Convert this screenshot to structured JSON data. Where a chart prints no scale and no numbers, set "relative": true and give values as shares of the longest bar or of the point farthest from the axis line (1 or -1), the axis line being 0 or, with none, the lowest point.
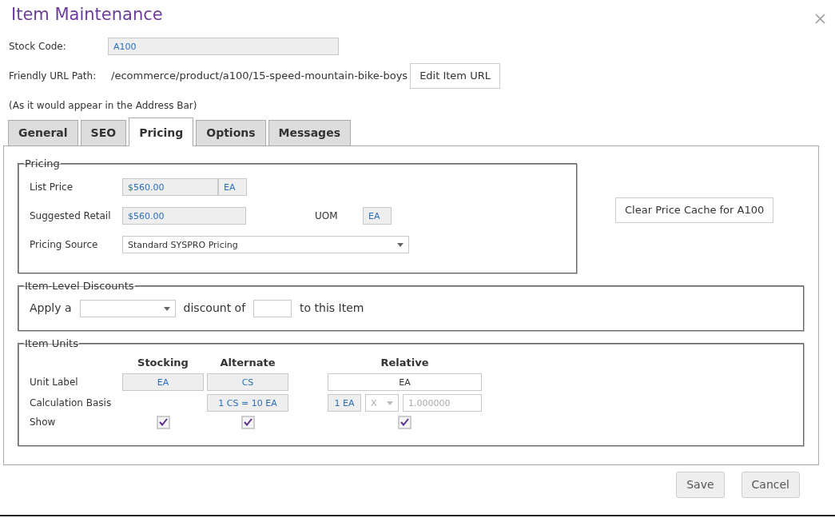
{
  "dialog": {
    "title": "Item Maintenance"
  },
  "header": {
    "stock_code": {
      "label": "Stock Code:",
      "value": "A100"
    },
    "url": {
      "label": "Friendly URL Path:",
      "value": "/ecommerce/product/a100/15-speed-mountain-bike-boys",
      "button": "Edit Item URL"
    },
    "note": "(As it would appear in the Address Bar)"
  },
  "tabs": [
    {
      "label": "General",
      "selected": false
    },
    {
      "label": "SEO",
      "selected": false
    },
    {
      "label": "Pricing",
      "selected": true
    },
    {
      "label": "Options",
      "selected": false
    },
    {
      "label": "Messages",
      "selected": false
    }
  ],
  "pricing": {
    "legend": "Pricing",
    "list_price": {
      "label": "List Price",
      "value": "$560.00",
      "unit": "EA"
    },
    "suggested_retail": {
      "label": "Suggested Retail",
      "value": "$560.00"
    },
    "uom": {
      "label": "UOM",
      "value": "EA"
    },
    "pricing_source": {
      "label": "Pricing Source",
      "value": "Standard SYSPRO Pricing"
    },
    "clear_button": "Clear Price Cache for A100"
  },
  "discounts": {
    "legend": "Item-Level Discounts",
    "prefix": "Apply a",
    "middle": "discount of",
    "suffix": "to this Item"
  },
  "units": {
    "legend": "Item Units",
    "columns": [
      "Stocking",
      "Alternate",
      "Relative"
    ],
    "unit_label": {
      "label": "Unit Label",
      "stocking": "EA",
      "alternate": "CS",
      "relative": "EA"
    },
    "calculation_basis": {
      "label": "Calculation Basis",
      "alternate": "1 CS = 10 EA",
      "relative_unit": "1 EA",
      "operator": "X",
      "factor": "1.000000"
    },
    "show": {
      "label": "Show",
      "stocking": true,
      "alternate": true,
      "relative": true
    }
  },
  "buttons": [
    "Save",
    "Cancel"
  ]
}
